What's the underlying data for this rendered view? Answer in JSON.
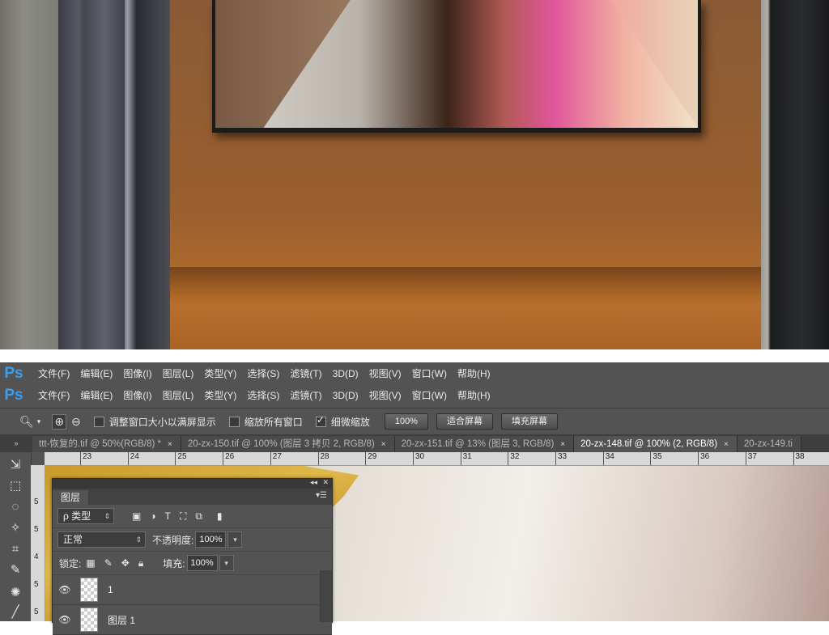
{
  "menubar": {
    "logo": "Ps",
    "items": [
      "文件(F)",
      "编辑(E)",
      "图像(I)",
      "图层(L)",
      "类型(Y)",
      "选择(S)",
      "滤镜(T)",
      "3D(D)",
      "视图(V)",
      "窗口(W)",
      "帮助(H)"
    ]
  },
  "options_bar": {
    "zoom_icon": "magnifier-icon",
    "cb_resize_label": "调整窗口大小以满屏显示",
    "cb_resize_checked": false,
    "cb_all_windows_label": "缩放所有窗口",
    "cb_all_windows_checked": false,
    "cb_scrubby_label": "细微缩放",
    "cb_scrubby_checked": true,
    "btn_100": "100%",
    "btn_fit": "适合屏幕",
    "btn_fill": "填充屏幕"
  },
  "doc_tabs": [
    {
      "title": "ttt-恢复的.tif @ 50%(RGB/8) *",
      "active": false
    },
    {
      "title": "20-zx-150.tif @ 100% (图层 3 拷贝 2, RGB/8)",
      "active": false
    },
    {
      "title": "20-zx-151.tif @ 13% (图层 3, RGB/8)",
      "active": false
    },
    {
      "title": "20-zx-148.tif @ 100% (2, RGB/8)",
      "active": true
    },
    {
      "title": "20-zx-149.ti",
      "active": false
    }
  ],
  "tab_close": "×",
  "ruler": {
    "h": [
      "23",
      "24",
      "25",
      "26",
      "27",
      "28",
      "29",
      "30",
      "31",
      "32",
      "33",
      "34",
      "35",
      "36",
      "37",
      "38"
    ],
    "v": [
      "5",
      "5",
      "4",
      "5",
      "5"
    ]
  },
  "layers_panel": {
    "tab": "图层",
    "filter_label": "ρ 类型",
    "blend_mode": "正常",
    "opacity_label": "不透明度:",
    "opacity_value": "100%",
    "lock_label": "锁定:",
    "fill_label": "填充:",
    "fill_value": "100%",
    "layers": [
      {
        "name": "1",
        "visible": true
      },
      {
        "name": "图层 1",
        "visible": true
      }
    ]
  },
  "colors": {
    "ps_blue": "#3a9df0",
    "ui_gray": "#535353",
    "gold": "#d9a93c"
  }
}
